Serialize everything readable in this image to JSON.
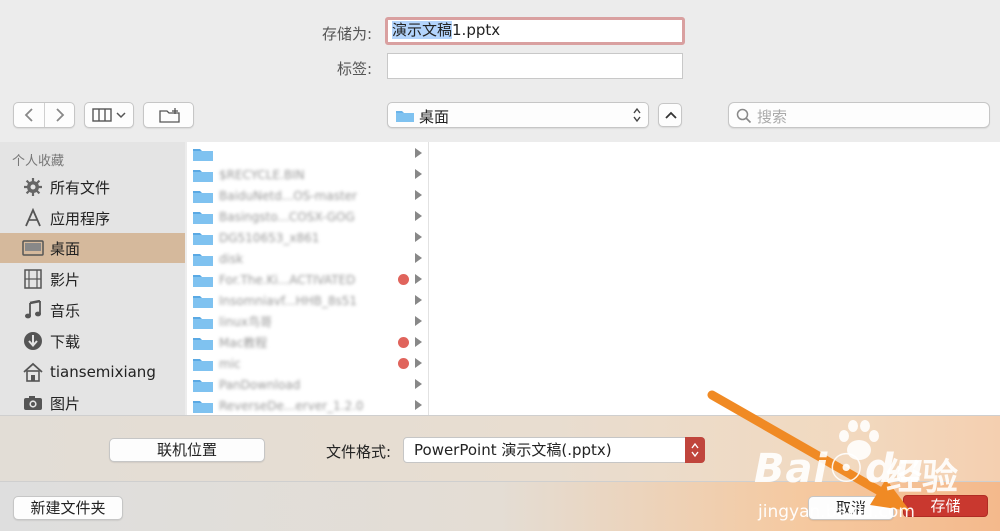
{
  "save_as": {
    "label": "存储为:",
    "value_selected": "演示文稿",
    "value_rest": "1.pptx"
  },
  "tags": {
    "label": "标签:",
    "value": ""
  },
  "toolbar": {
    "back_icon": "chevron-left-icon",
    "forward_icon": "chevron-right-icon",
    "view_icon": "column-view-icon",
    "new_folder_icon": "new-folder-icon",
    "location": "桌面",
    "search_placeholder": "搜索"
  },
  "sidebar": {
    "header": "个人收藏",
    "items": [
      {
        "label": "所有文件",
        "icon": "gear-icon"
      },
      {
        "label": "应用程序",
        "icon": "applications-icon"
      },
      {
        "label": "桌面",
        "icon": "desktop-icon",
        "active": true
      },
      {
        "label": "影片",
        "icon": "film-icon"
      },
      {
        "label": "音乐",
        "icon": "music-icon"
      },
      {
        "label": "下载",
        "icon": "download-icon"
      },
      {
        "label": "tiansemixiang",
        "icon": "home-icon"
      },
      {
        "label": "图片",
        "icon": "camera-icon"
      }
    ]
  },
  "files": [
    {
      "name": "",
      "tag": false
    },
    {
      "name": "$RECYCLE.BIN",
      "tag": false
    },
    {
      "name": "BaiduNetd...OS-master",
      "tag": false
    },
    {
      "name": "Basingsto...COSX-GOG",
      "tag": false
    },
    {
      "name": "DG510653_x861",
      "tag": false
    },
    {
      "name": "disk",
      "tag": false
    },
    {
      "name": "For.The.Ki...ACTIVATED",
      "tag": true
    },
    {
      "name": "Insomniavf...HHB_8s51",
      "tag": false
    },
    {
      "name": "linux鸟哥",
      "tag": false
    },
    {
      "name": "Mac教程",
      "tag": true
    },
    {
      "name": "mic",
      "tag": true
    },
    {
      "name": "PanDownload",
      "tag": false
    },
    {
      "name": "ReverseDe...erver_1.2.0",
      "tag": false
    }
  ],
  "options": {
    "online_locations_label": "联机位置",
    "format_label": "文件格式:",
    "format_value": "PowerPoint 演示文稿(.pptx)"
  },
  "bottom": {
    "new_folder_label": "新建文件夹",
    "cancel_label": "取消",
    "save_label": "存储"
  },
  "watermark": {
    "logo": "Bai☉du",
    "cn": "经验",
    "url": "jingyan.baidu.com"
  },
  "colors": {
    "accent_red": "#c9382f",
    "sidebar_active": "#d5b99c",
    "folder_blue": "#6ab4ea",
    "tag_red": "#e0645c",
    "annotation_arrow": "#f08a24"
  }
}
